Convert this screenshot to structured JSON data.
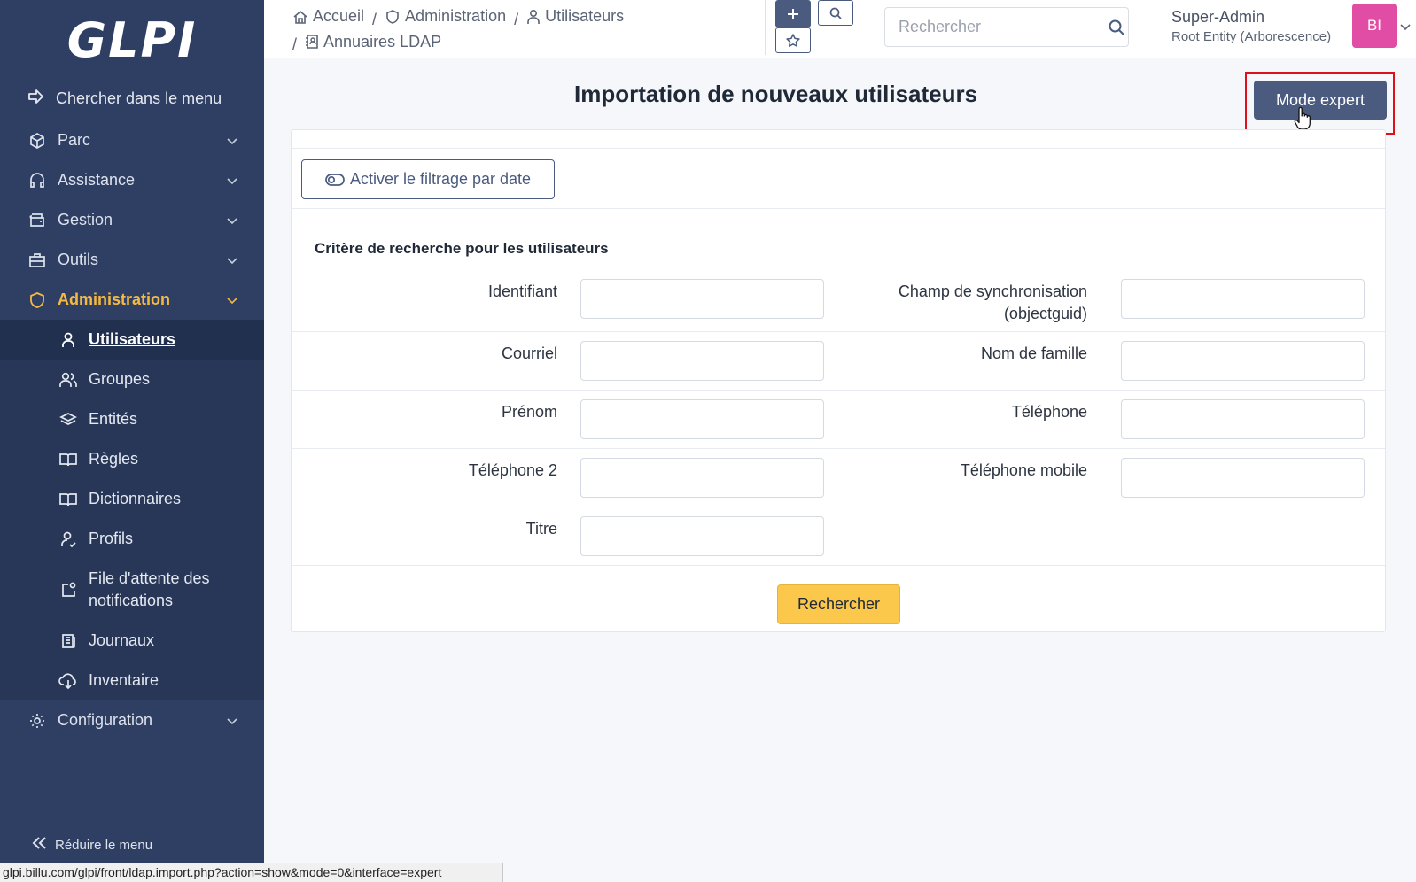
{
  "app": {
    "logo": "GLPI"
  },
  "sidebar": {
    "search_label": "Chercher dans le menu",
    "items": [
      {
        "label": "Parc",
        "icon": "box-icon"
      },
      {
        "label": "Assistance",
        "icon": "headset-icon"
      },
      {
        "label": "Gestion",
        "icon": "wallet-icon"
      },
      {
        "label": "Outils",
        "icon": "briefcase-icon"
      },
      {
        "label": "Administration",
        "icon": "shield-icon"
      }
    ],
    "subitems": [
      {
        "label": "Utilisateurs",
        "icon": "user-icon"
      },
      {
        "label": "Groupes",
        "icon": "users-icon"
      },
      {
        "label": "Entités",
        "icon": "stack-icon"
      },
      {
        "label": "Règles",
        "icon": "book-icon"
      },
      {
        "label": "Dictionnaires",
        "icon": "book-icon"
      },
      {
        "label": "Profils",
        "icon": "user-check-icon"
      },
      {
        "label": "File d'attente des notifications",
        "icon": "notification-icon"
      },
      {
        "label": "Journaux",
        "icon": "news-icon"
      },
      {
        "label": "Inventaire",
        "icon": "cloud-download-icon"
      }
    ],
    "config_label": "Configuration",
    "reduce_label": "Réduire le menu",
    "active_color": "#f5b940"
  },
  "header": {
    "breadcrumb": {
      "home": "Accueil",
      "admin": "Administration",
      "users": "Utilisateurs",
      "ldap": "Annuaires LDAP"
    },
    "search_placeholder": "Rechercher",
    "user_name": "Super-Admin",
    "entity": "Root Entity (Arborescence)",
    "avatar_initials": "BI",
    "avatar_color": "#e14ca4"
  },
  "main": {
    "title": "Importation de nouveaux utilisateurs",
    "expert_button": "Mode expert",
    "date_filter_button": "Activer le filtrage par date",
    "section_title": "Critère de recherche pour les utilisateurs",
    "fields": {
      "login": "Identifiant",
      "sync_field": "Champ de synchronisation (objectguid)",
      "email": "Courriel",
      "lastname": "Nom de famille",
      "firstname": "Prénom",
      "phone": "Téléphone",
      "phone2": "Téléphone 2",
      "mobile": "Téléphone mobile",
      "title": "Titre"
    },
    "submit_button": "Rechercher",
    "accent_color": "#fcc84c",
    "primary_color": "#4b5b80"
  },
  "status_bar": {
    "url": "glpi.billu.com/glpi/front/ldap.import.php?action=show&mode=0&interface=expert"
  }
}
